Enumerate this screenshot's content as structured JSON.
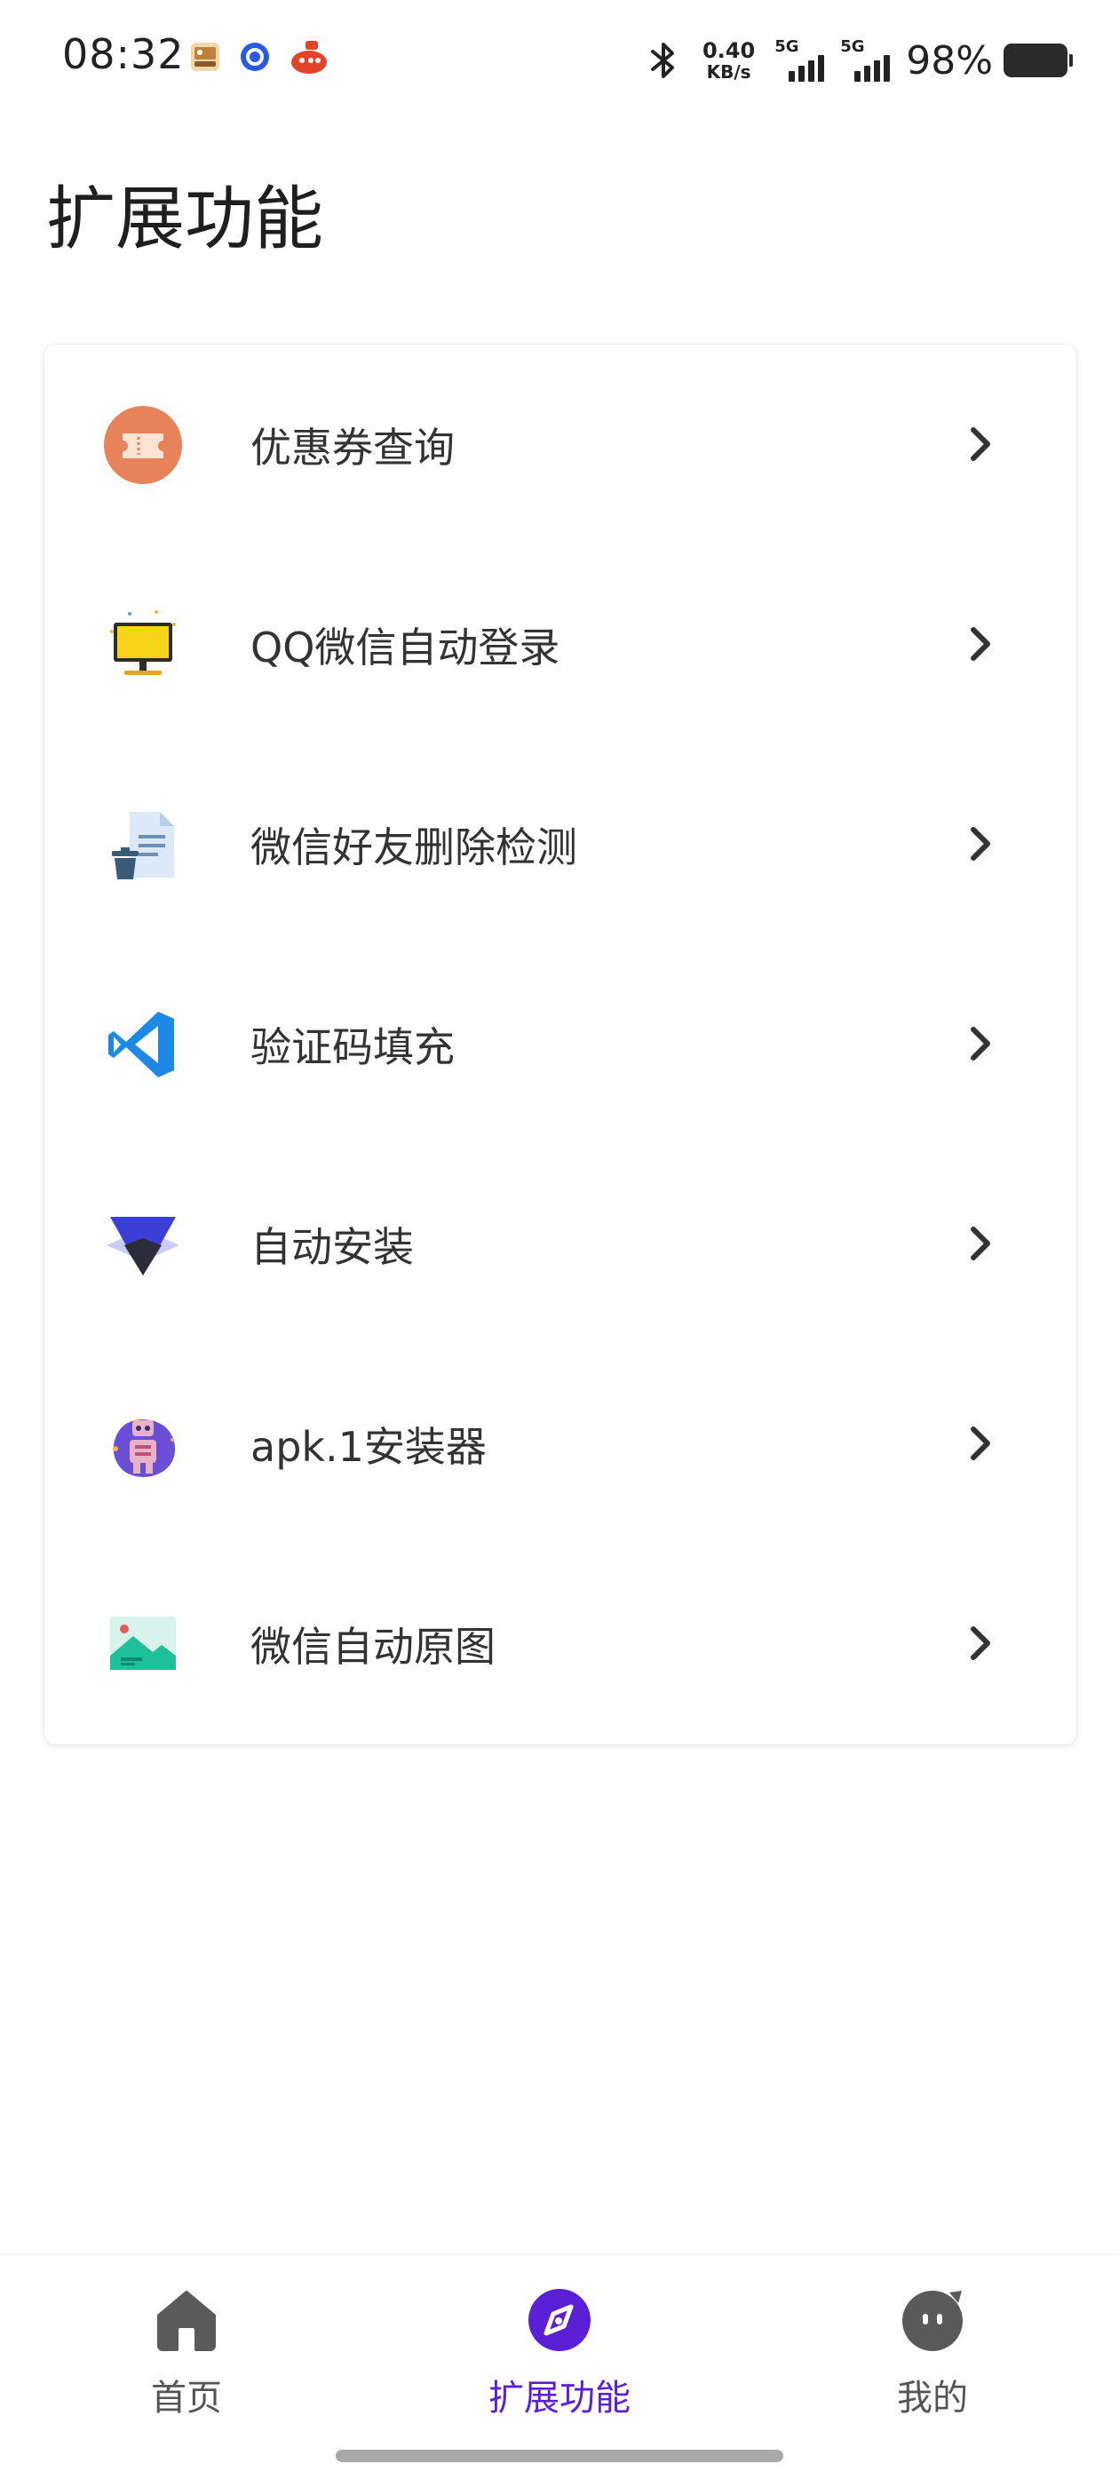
{
  "status_bar": {
    "time": "08:32",
    "net_speed_value": "0.40",
    "net_speed_unit": "KB/s",
    "sim1_label": "5G",
    "sim2_label": "5G",
    "battery_percent": "98%",
    "icons": [
      "gallery-notification-icon",
      "blue-circle-app-icon",
      "red-app-icon",
      "bluetooth-icon",
      "signal-icon",
      "battery-icon"
    ]
  },
  "page": {
    "title": "扩展功能"
  },
  "features": [
    {
      "label": "优惠券查询",
      "icon": "coupon-icon"
    },
    {
      "label": "QQ微信自动登录",
      "icon": "monitor-login-icon"
    },
    {
      "label": "微信好友删除检测",
      "icon": "document-trash-icon"
    },
    {
      "label": "验证码填充",
      "icon": "code-editor-icon"
    },
    {
      "label": "自动安装",
      "icon": "install-arrow-icon"
    },
    {
      "label": "apk.1安装器",
      "icon": "robot-icon"
    },
    {
      "label": "微信自动原图",
      "icon": "image-icon"
    }
  ],
  "bottom_nav": {
    "items": [
      {
        "label": "首页",
        "icon": "home-icon",
        "active": false
      },
      {
        "label": "扩展功能",
        "icon": "compass-icon",
        "active": true
      },
      {
        "label": "我的",
        "icon": "profile-face-icon",
        "active": false
      }
    ]
  },
  "colors": {
    "accent": "#5b1fd6",
    "coupon": "#e8825a",
    "chevron": "#333333"
  }
}
